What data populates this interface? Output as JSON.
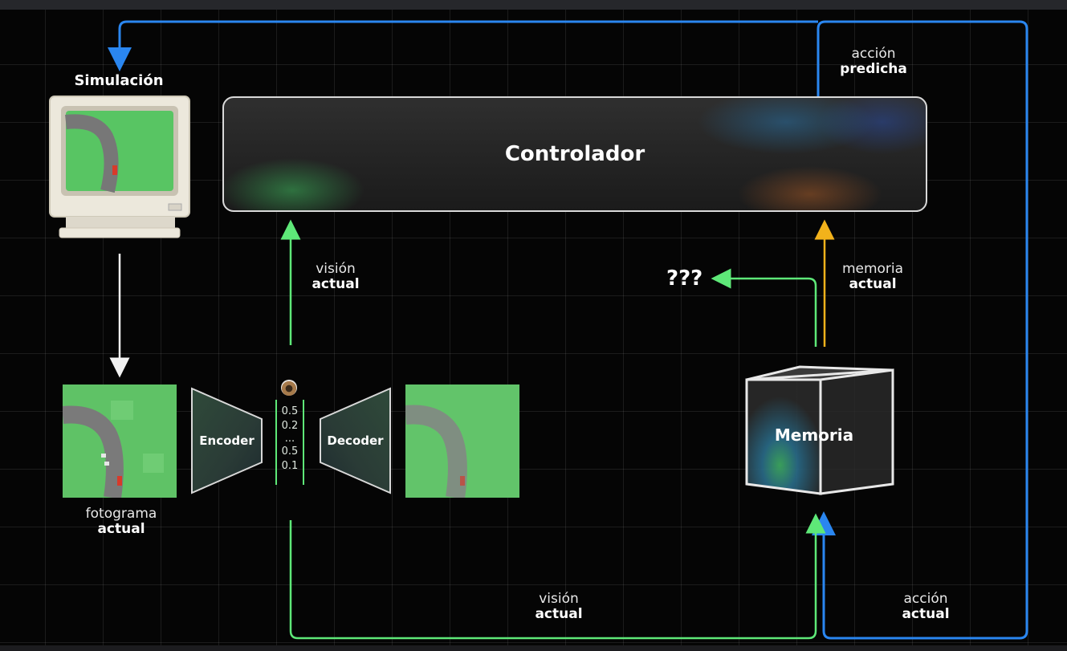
{
  "colors": {
    "background": "#050505",
    "grid": "#1f1f1f",
    "green_arrow": "#5ee878",
    "blue_arrow": "#2a86f0",
    "orange_arrow": "#f2b21b",
    "white_arrow": "#f2f2f2"
  },
  "simulation": {
    "title": "Simulación"
  },
  "controller": {
    "title": "Controlador"
  },
  "labels": {
    "predicted_action": {
      "line1": "acción",
      "line2": "predicha"
    },
    "current_vision_top": {
      "line1": "visión",
      "line2": "actual"
    },
    "current_memory": {
      "line1": "memoria",
      "line2": "actual"
    },
    "current_frame": {
      "line1": "fotograma",
      "line2": "actual"
    },
    "current_vision_bottom": {
      "line1": "visión",
      "line2": "actual"
    },
    "current_action": {
      "line1": "acción",
      "line2": "actual"
    }
  },
  "encoder": {
    "label": "Encoder"
  },
  "decoder": {
    "label": "Decoder"
  },
  "latent_vector": {
    "values": [
      "0.5",
      "0.2",
      "...",
      "0.5",
      "0.1"
    ]
  },
  "unknown_output": "???",
  "memory": {
    "title": "Memoria"
  },
  "icons": [
    "eye-icon",
    "crt-monitor-icon",
    "race-car-icon"
  ]
}
